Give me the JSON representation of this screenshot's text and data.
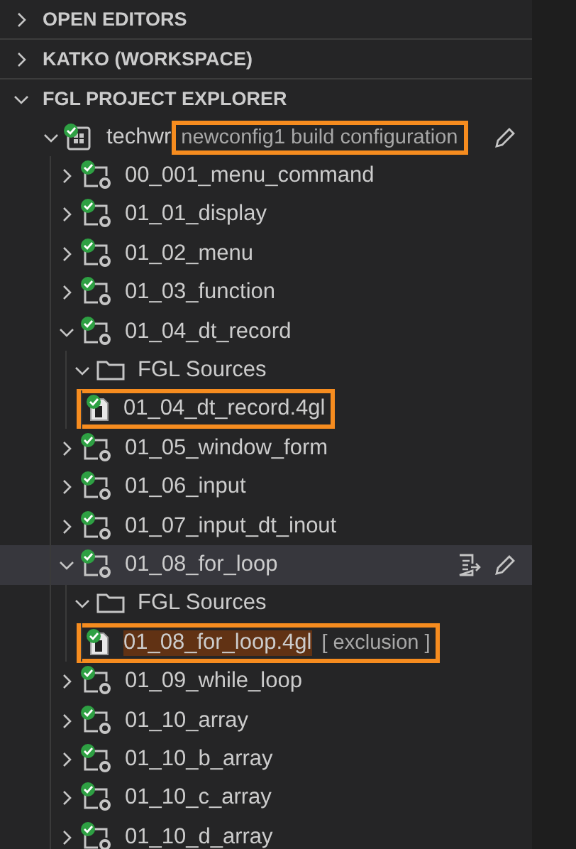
{
  "sections": [
    {
      "label": "OPEN EDITORS",
      "expanded": false
    },
    {
      "label": "KATKO (WORKSPACE)",
      "expanded": false
    },
    {
      "label": "FGL PROJECT EXPLORER",
      "expanded": true
    }
  ],
  "tree": [
    {
      "kind": "config",
      "label": "techwr",
      "description": "newconfig1 build configuration",
      "annotated": true,
      "expanded": true,
      "selected": false,
      "build_action": false,
      "edit_action": true,
      "children": [
        {
          "kind": "program",
          "label": "00_001_menu_command",
          "expanded": false,
          "selected": false
        },
        {
          "kind": "program",
          "label": "01_01_display",
          "expanded": false,
          "selected": false
        },
        {
          "kind": "program",
          "label": "01_02_menu",
          "expanded": false,
          "selected": false
        },
        {
          "kind": "program",
          "label": "01_03_function",
          "expanded": false,
          "selected": false
        },
        {
          "kind": "program",
          "label": "01_04_dt_record",
          "expanded": true,
          "selected": false,
          "children": [
            {
              "kind": "folder",
              "label": "FGL Sources",
              "expanded": true,
              "selected": false,
              "children": [
                {
                  "kind": "file",
                  "label": "01_04_dt_record.4gl",
                  "annotated": true,
                  "highlighted": false,
                  "selected": false
                }
              ]
            }
          ]
        },
        {
          "kind": "program",
          "label": "01_05_window_form",
          "expanded": false,
          "selected": false
        },
        {
          "kind": "program",
          "label": "01_06_input",
          "expanded": false,
          "selected": false
        },
        {
          "kind": "program",
          "label": "01_07_input_dt_inout",
          "expanded": false,
          "selected": false
        },
        {
          "kind": "program",
          "label": "01_08_for_loop",
          "expanded": true,
          "selected": true,
          "build_action": true,
          "edit_action": true,
          "children": [
            {
              "kind": "folder",
              "label": "FGL Sources",
              "expanded": true,
              "selected": false,
              "children": [
                {
                  "kind": "file",
                  "label": "01_08_for_loop.4gl",
                  "tag": "[ exclusion ]",
                  "annotated": true,
                  "highlighted": true,
                  "selected": false
                }
              ]
            }
          ]
        },
        {
          "kind": "program",
          "label": "01_09_while_loop",
          "expanded": false,
          "selected": false
        },
        {
          "kind": "program",
          "label": "01_10_array",
          "expanded": false,
          "selected": false
        },
        {
          "kind": "program",
          "label": "01_10_b_array",
          "expanded": false,
          "selected": false
        },
        {
          "kind": "program",
          "label": "01_10_c_array",
          "expanded": false,
          "selected": false
        },
        {
          "kind": "program",
          "label": "01_10_d_array",
          "expanded": false,
          "selected": false
        }
      ]
    }
  ]
}
